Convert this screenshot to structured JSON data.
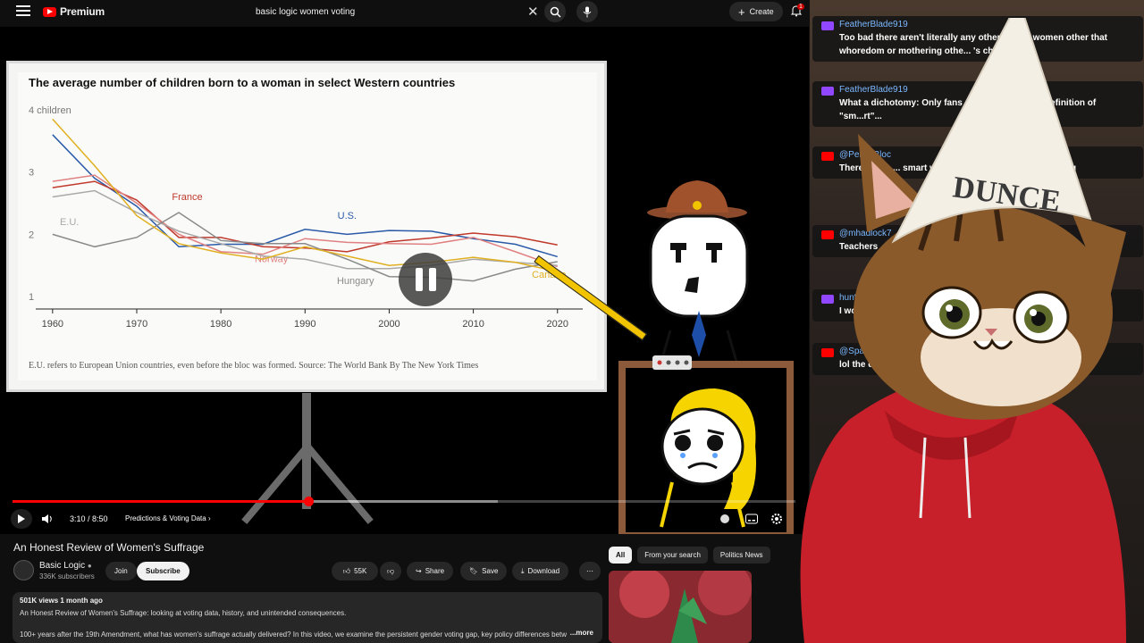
{
  "topbar": {
    "logo_text": "Premium",
    "search_query": "basic logic women voting",
    "create_label": "Create",
    "notif_count": "1"
  },
  "video": {
    "chart": {
      "title": "The average number of children born to a woman in select Western countries",
      "note": "E.U. refers to European Union countries, even before the bloc was formed.  Source: The World Bank  By The New York Times"
    },
    "time_label": "3:10 / 8:50",
    "chapter_label": "Predictions & Voting Data",
    "progress_fraction": 0.378
  },
  "chart_data": {
    "type": "line",
    "title": "The average number of children born to a woman in select Western countries",
    "x": [
      1960,
      1965,
      1970,
      1975,
      1980,
      1985,
      1990,
      1995,
      2000,
      2005,
      2010,
      2015,
      2020
    ],
    "xlim": [
      1958,
      2023
    ],
    "ylim": [
      0.8,
      4.2
    ],
    "y_ticks": [
      "1",
      "2",
      "3",
      "4 children"
    ],
    "x_ticks": [
      "1960",
      "1970",
      "1980",
      "1990",
      "2000",
      "2010",
      "2020"
    ],
    "series": [
      {
        "name": "U.S.",
        "color": "#2a5aa8",
        "values": [
          3.6,
          2.9,
          2.45,
          1.8,
          1.84,
          1.84,
          2.08,
          2.0,
          2.06,
          2.05,
          1.93,
          1.84,
          1.64
        ]
      },
      {
        "name": "France",
        "color": "#c0392b",
        "values": [
          2.75,
          2.85,
          2.55,
          1.95,
          1.95,
          1.8,
          1.78,
          1.72,
          1.88,
          1.94,
          2.02,
          1.96,
          1.83
        ]
      },
      {
        "name": "Norway",
        "color": "#e08080",
        "values": [
          2.85,
          2.95,
          2.5,
          2.0,
          1.72,
          1.68,
          1.93,
          1.87,
          1.85,
          1.84,
          1.95,
          1.72,
          1.48
        ]
      },
      {
        "name": "E.U.",
        "color": "#a9a9a9",
        "values": [
          2.6,
          2.7,
          2.35,
          2.05,
          1.85,
          1.65,
          1.6,
          1.45,
          1.45,
          1.5,
          1.6,
          1.55,
          1.5
        ]
      },
      {
        "name": "Hungary",
        "color": "#8a8a8a",
        "values": [
          2.0,
          1.8,
          1.95,
          2.35,
          1.9,
          1.85,
          1.85,
          1.6,
          1.32,
          1.31,
          1.25,
          1.44,
          1.56
        ]
      },
      {
        "name": "Canada",
        "color": "#e0b020",
        "values": [
          3.85,
          3.1,
          2.3,
          1.85,
          1.7,
          1.6,
          1.8,
          1.65,
          1.5,
          1.55,
          1.63,
          1.55,
          1.4
        ]
      }
    ]
  },
  "below": {
    "title": "An Honest Review of Women's Suffrage",
    "channel_name": "Basic Logic",
    "channel_subs": "336K subscribers",
    "join_label": "Join",
    "subscribe_label": "Subscribe",
    "likes": "55K",
    "share_label": "Share",
    "save_label": "Save",
    "download_label": "Download",
    "views_meta": "501K views  1 month ago",
    "desc_line1": "An Honest Review of Women's Suffrage: looking at voting data, history, and unintended consequences.",
    "desc_line2": "100+ years after the 19th Amendment, what has women's suffrage actually delivered? In this video, we examine the persistent gender voting gap, key policy differences betwe",
    "more_label": "...more",
    "chips": [
      "All",
      "From your search",
      "Politics News"
    ]
  },
  "chat": {
    "messages": [
      {
        "platform": "twitch",
        "user": "FeatherBlade919",
        "text": "Too bad there aren't literally any other opt... r women other that whoredom or mothering othe... 's children/"
      },
      {
        "platform": "twitch",
        "user": "FeatherBlade919",
        "text": "What a dichotomy: Only fans or te... or a certain definition of \"sm...rt\"..."
      },
      {
        "platform": "youtube",
        "user": "@PennyBloc",
        "text": "There was a ... smart women whe... r than K-12 teaching"
      },
      {
        "platform": "youtube",
        "user": "@mhadlock7",
        "text": "Teachers ... to allow ..."
      },
      {
        "platform": "twitch",
        "user": "huntrx_",
        "text": "I wouldn't ..."
      },
      {
        "platform": "youtube",
        "user": "@Spartanbot1001",
        "text": "lol the dis... maybe the wo... e. look up mara..."
      }
    ],
    "hat_text": "DUNCE"
  },
  "colors": {
    "accent": "#ff0000",
    "twitch": "#9146ff",
    "youtube": "#ff0000"
  }
}
